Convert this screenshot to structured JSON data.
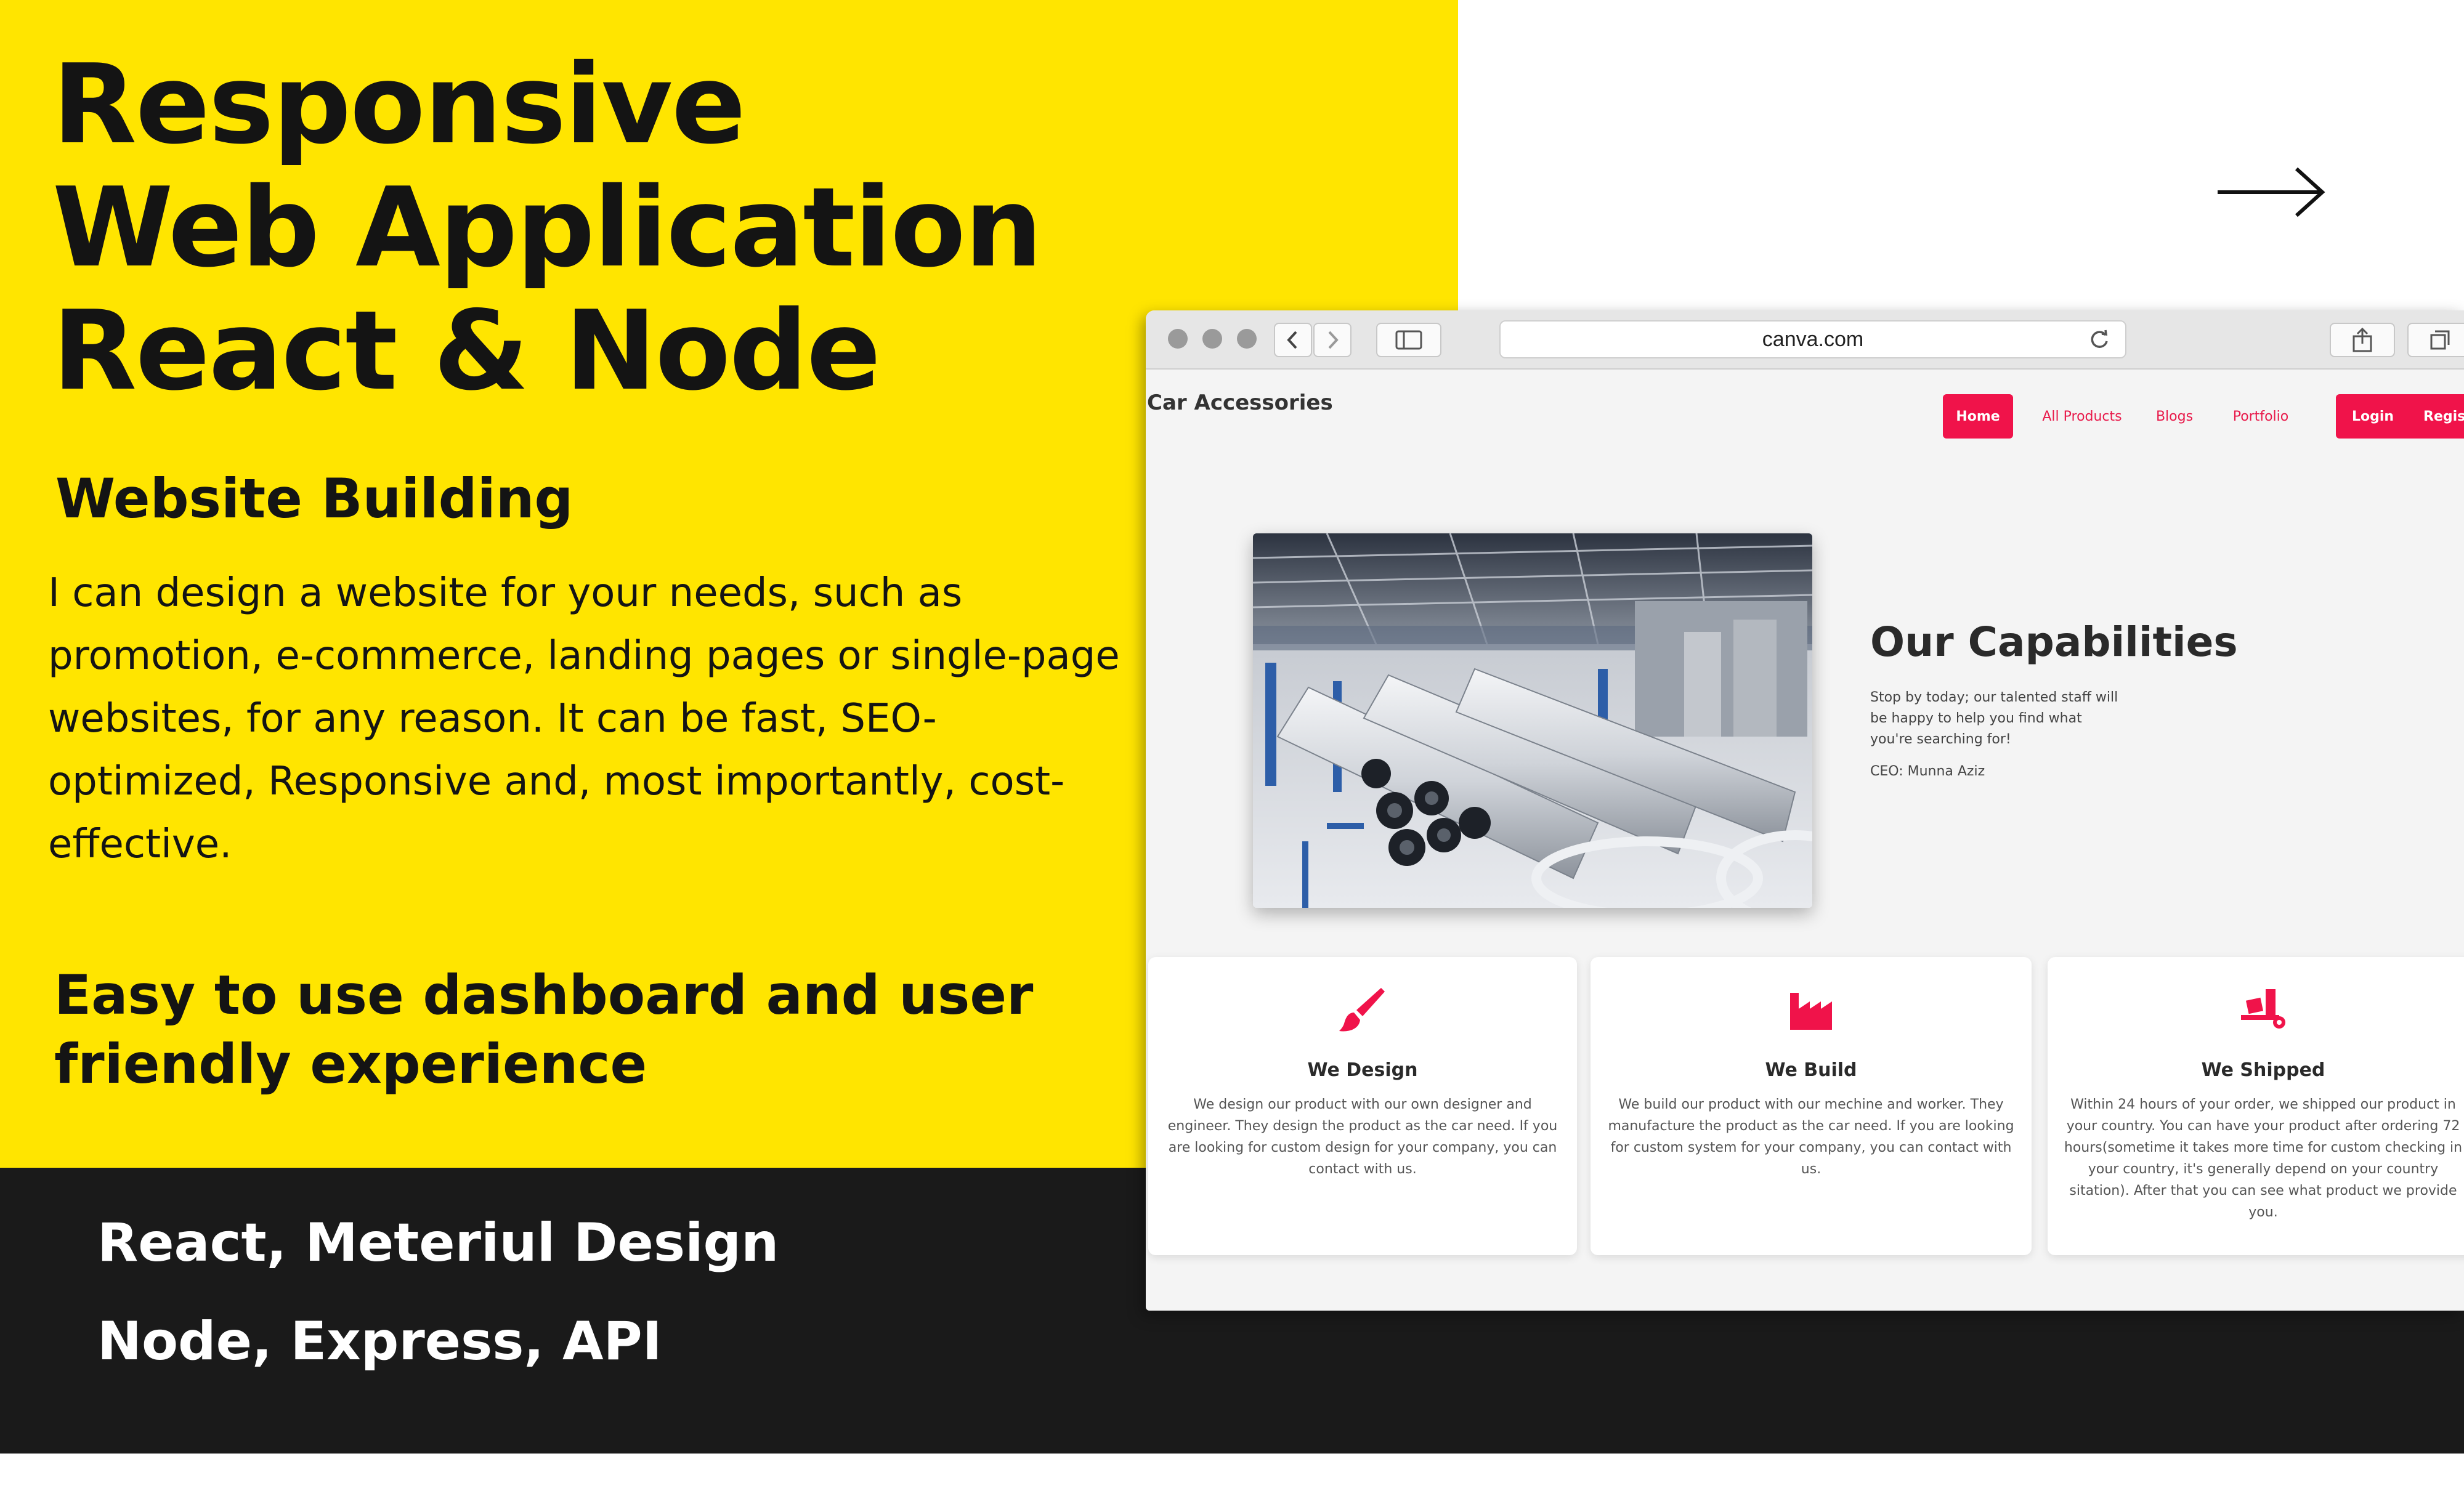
{
  "promo": {
    "title_lines": [
      "Responsive",
      "Web Application",
      "React & Node"
    ],
    "subtitle": "Website Building",
    "description": "I can design a website for your needs, such as promotion, e-commerce, landing pages or single-page websites, for any reason. It can be fast, SEO-optimized, Responsive and, most importantly, cost-effective.",
    "dashboard_text": "Easy to use dashboard and user friendly experience",
    "stack": [
      "React, Meteriul Design",
      "Node, Express, API"
    ]
  },
  "colors": {
    "yellow": "#FFE500",
    "dark": "#1a1a1a",
    "accent": "#f0134a"
  },
  "browser": {
    "url": "canva.com"
  },
  "site": {
    "brand": "Car Accessories",
    "nav": {
      "home": "Home",
      "all_products": "All Products",
      "blogs": "Blogs",
      "portfolio": "Portfolio",
      "login": "Login",
      "register": "Register"
    },
    "capabilities": {
      "title": "Our Capabilities",
      "text": "Stop by today; our talented staff will be happy to help you find what you're searching for!",
      "ceo": "CEO: Munna Aziz"
    },
    "cards": [
      {
        "icon": "paintbrush-icon",
        "title": "We Design",
        "text": "We design our product with our own designer and engineer. They design the product as the car need. If you are looking for custom design for your company, you can contact with us."
      },
      {
        "icon": "factory-icon",
        "title": "We Build",
        "text": "We build our product with our mechine and worker. They manufacture the product as the car need. If you are looking for custom system for your company, you can contact with us."
      },
      {
        "icon": "truck-loading-icon",
        "title": "We Shipped",
        "text": "Within 24 hours of your order, we shipped our product in your country. You can have your product after ordering 72 hours(sometime it takes more time for custom checking in your country, it's generally depend on your country sitation). After that you can see what product we provide you."
      }
    ]
  }
}
